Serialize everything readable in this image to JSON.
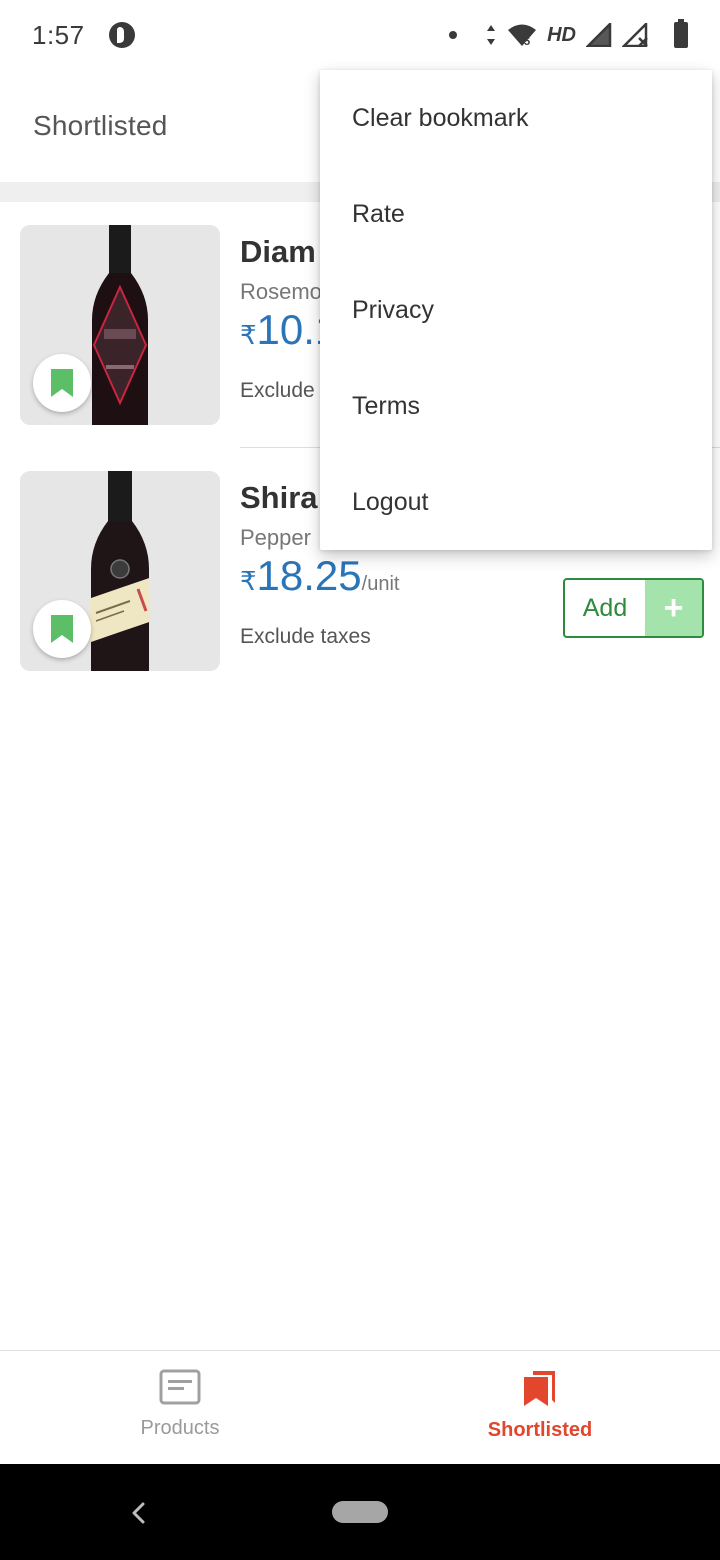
{
  "status_bar": {
    "time": "1:57",
    "network_label": "HD",
    "icons": [
      "p-icon",
      "notification-dot-icon",
      "data-arrows-icon",
      "wifi-icon",
      "signal-icon",
      "signal-no-service-icon",
      "battery-charging-icon"
    ]
  },
  "app_bar": {
    "title": "Shortlisted"
  },
  "menu": {
    "items": [
      {
        "label": "Clear bookmark"
      },
      {
        "label": "Rate"
      },
      {
        "label": "Privacy"
      },
      {
        "label": "Terms"
      },
      {
        "label": "Logout"
      }
    ]
  },
  "products": [
    {
      "name": "Diam",
      "desc": "Rosemo",
      "currency": "₹",
      "price": "10.1",
      "unit": "",
      "tax_note": "Exclude",
      "bookmarked": true
    },
    {
      "name": "Shira",
      "desc": "Pepper",
      "currency": "₹",
      "price": "18.25",
      "unit": "/unit",
      "tax_note": "Exclude taxes",
      "bookmarked": true,
      "add_label": "Add",
      "add_plus": "+"
    }
  ],
  "bottom_nav": {
    "items": [
      {
        "label": "Products",
        "icon": "article-icon",
        "active": false
      },
      {
        "label": "Shortlisted",
        "icon": "bookmarks-icon",
        "active": true
      }
    ]
  },
  "colors": {
    "accent_red": "#e2462c",
    "price_blue": "#2a74b8",
    "add_green": "#2e8b3d",
    "bookmark_green": "#5cbf67"
  }
}
